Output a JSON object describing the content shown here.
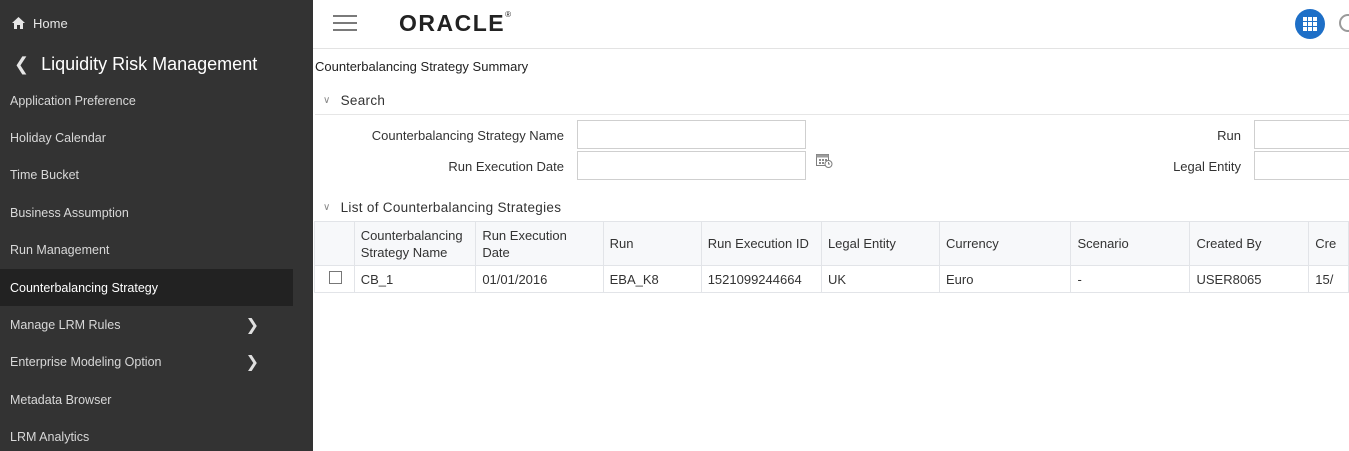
{
  "sidebar": {
    "home_label": "Home",
    "module_title": "Liquidity Risk Management",
    "items": [
      {
        "label": "Application Preference",
        "has_children": false
      },
      {
        "label": "Holiday Calendar",
        "has_children": false
      },
      {
        "label": "Time Bucket",
        "has_children": false
      },
      {
        "label": "Business Assumption",
        "has_children": false
      },
      {
        "label": "Run Management",
        "has_children": false
      },
      {
        "label": "Counterbalancing Strategy",
        "has_children": false,
        "active": true
      },
      {
        "label": "Manage LRM Rules",
        "has_children": true
      },
      {
        "label": "Enterprise Modeling Option",
        "has_children": true
      },
      {
        "label": "Metadata Browser",
        "has_children": false
      },
      {
        "label": "LRM Analytics",
        "has_children": false
      }
    ]
  },
  "header": {
    "logo": "ORACLE",
    "apps_icon": "grid-icon"
  },
  "page": {
    "title": "Counterbalancing Strategy Summary"
  },
  "search": {
    "section_label": "Search",
    "strategy_name_label": "Counterbalancing Strategy Name",
    "strategy_name_value": "",
    "run_execution_date_label": "Run Execution Date",
    "run_execution_date_value": "",
    "run_label": "Run",
    "run_value": "",
    "legal_entity_label": "Legal Entity",
    "legal_entity_value": ""
  },
  "list": {
    "section_label": "List of Counterbalancing Strategies",
    "columns": [
      "Counterbalancing Strategy Name",
      "Run Execution Date",
      "Run",
      "Run Execution ID",
      "Legal Entity",
      "Currency",
      "Scenario",
      "Created By",
      "Cre"
    ],
    "rows": [
      [
        "CB_1",
        "01/01/2016",
        "EBA_K8",
        "1521099244664",
        "UK",
        "Euro",
        "-",
        "USER8065",
        "15/"
      ]
    ]
  },
  "colors": {
    "sidebar_bg": "#333333",
    "sidebar_active_bg": "#222222",
    "accent": "#1e6fc7"
  }
}
